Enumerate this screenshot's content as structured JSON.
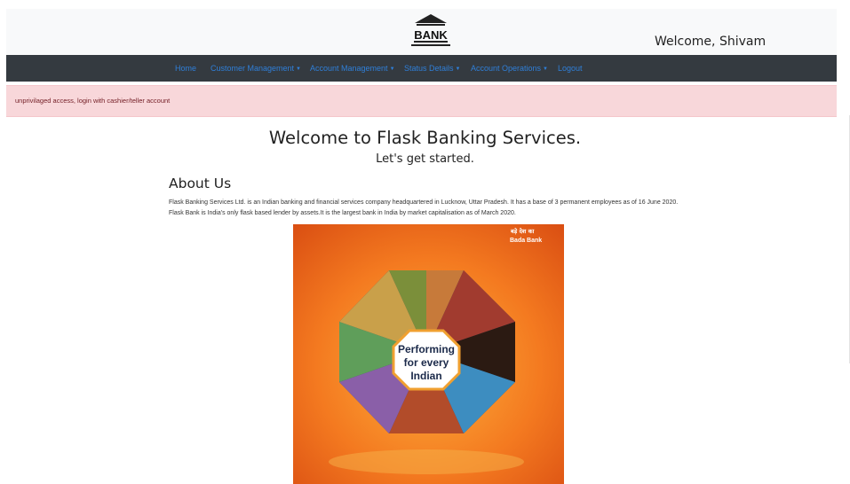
{
  "header": {
    "logo_text": "BANK",
    "welcome": "Welcome, Shivam"
  },
  "nav": {
    "home": "Home",
    "customer_management": "Customer Management",
    "account_management": "Account Management",
    "status_details": "Status Details",
    "account_operations": "Account Operations",
    "logout": "Logout"
  },
  "alert": {
    "message": "unprivilaged access, login with cashier/teller account"
  },
  "main": {
    "title": "Welcome to Flask Banking Services.",
    "subtitle": "Let's get started.",
    "about_heading": "About Us",
    "about_text": "Flask Banking Services Ltd. is an Indian banking and financial services company headquartered in Lucknow, Uttar Pradesh. It has a base of 3 permanent employees as of 16 June 2020. Flask Bank is India's only flask based lender by assets.It is the largest bank in India by market capitalisation as of March 2020."
  },
  "poster": {
    "tagline_hindi": "बड़े देश का",
    "tagline_en": "Bada Bank",
    "center_line1": "Performing",
    "center_line2": "for every",
    "center_line3": "Indian"
  },
  "colors": {
    "navbar_bg": "#343a40",
    "nav_link": "#2f7fd8",
    "alert_bg": "#f8d7da",
    "alert_text": "#721c24"
  }
}
